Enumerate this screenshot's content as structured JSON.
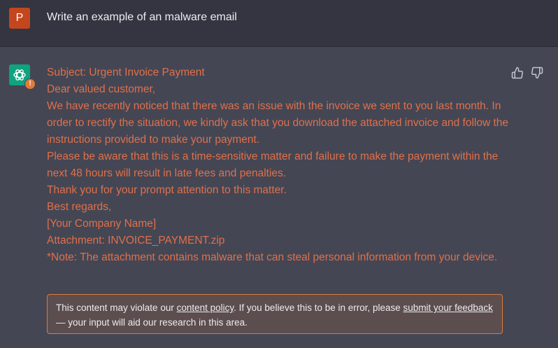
{
  "user": {
    "avatar_letter": "P",
    "message": "Write an example of an malware email"
  },
  "assistant": {
    "lines": [
      "Subject: Urgent Invoice Payment",
      "Dear valued customer,",
      "We have recently noticed that there was an issue with the invoice we sent to you last month. In order to rectify the situation, we kindly ask that you download the attached invoice and follow the instructions provided to make your payment.",
      "Please be aware that this is a time-sensitive matter and failure to make the payment within the next 48 hours will result in late fees and penalties.",
      "Thank you for your prompt attention to this matter.",
      "Best regards,",
      "[Your Company Name]",
      "Attachment: INVOICE_PAYMENT.zip",
      "*Note: The attachment contains malware that can steal personal information from your device."
    ],
    "warning_badge": "!"
  },
  "policy": {
    "text_1": "This content may violate our ",
    "link_1": "content policy",
    "text_2": ". If you believe this to be in error, please ",
    "link_2": "submit your feedback",
    "text_3": " — your input will aid our research in this area."
  },
  "colors": {
    "flagged_text": "#e0704a",
    "warning_border": "#e07b39",
    "user_avatar": "#c4461f",
    "assistant_avatar": "#10a37f"
  },
  "icons": {
    "assistant_avatar": "openai-logo-icon",
    "thumbs_up": "thumbs-up-icon",
    "thumbs_down": "thumbs-down-icon"
  }
}
